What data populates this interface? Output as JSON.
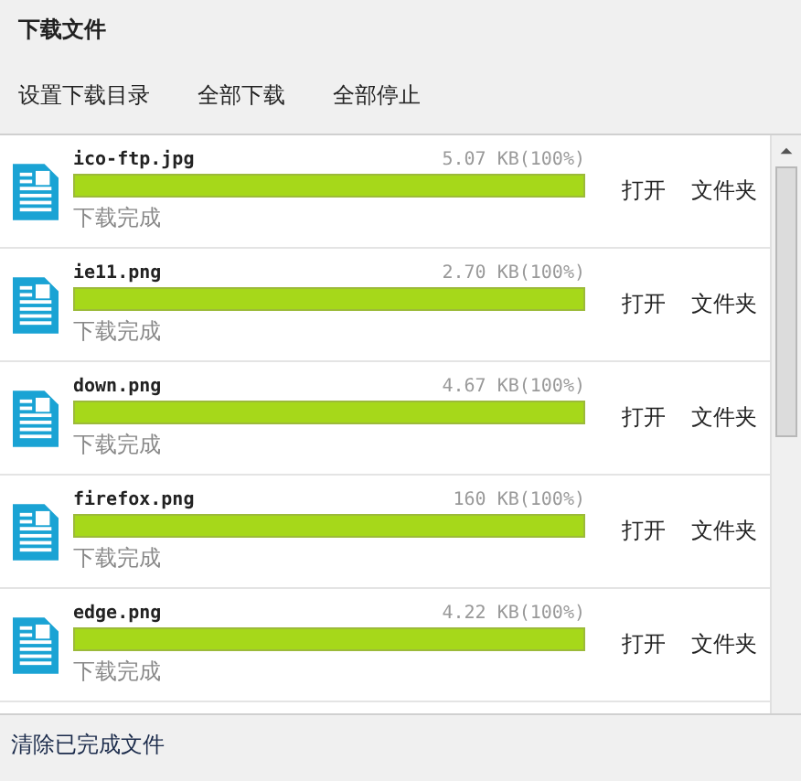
{
  "window": {
    "title": "下载文件"
  },
  "toolbar": [
    "设置下载目录",
    "全部下载",
    "全部停止"
  ],
  "files": [
    {
      "name": "ico-ftp.jpg",
      "size": "5.07 KB(100%)",
      "level": 1,
      "status": "下载完成",
      "actions": [
        "打开",
        "文件夹"
      ]
    },
    {
      "name": "ie11.png",
      "size": "2.70 KB(100%)",
      "level": 1,
      "status": "下载完成",
      "actions": [
        "打开",
        "文件夹"
      ]
    },
    {
      "name": "down.png",
      "size": "4.67 KB(100%)",
      "level": 1,
      "status": "下载完成",
      "actions": [
        "打开",
        "文件夹"
      ]
    },
    {
      "name": "firefox.png",
      "size": "160 KB(100%)",
      "level": 1,
      "status": "下载完成",
      "actions": [
        "打开",
        "文件夹"
      ]
    },
    {
      "name": "edge.png",
      "size": "4.22 KB(100%)",
      "level": 1,
      "status": "下载完成",
      "actions": [
        "打开",
        "文件夹"
      ]
    }
  ],
  "footer": {
    "link": "清除已完成文件"
  }
}
